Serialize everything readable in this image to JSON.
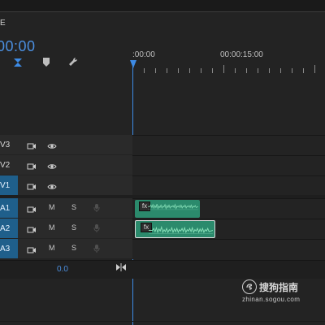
{
  "window": {
    "panel_tab_glyph": "E"
  },
  "timeline": {
    "timecode": "00:00",
    "ruler": {
      "labels": [
        ":00:00",
        "00:00:15:00"
      ]
    },
    "audio_meter_value": "0.0"
  },
  "tracks": {
    "video": [
      {
        "name": "V3",
        "active": false
      },
      {
        "name": "V2",
        "active": false
      },
      {
        "name": "V1",
        "active": true
      }
    ],
    "audio": [
      {
        "name": "A1",
        "active": true,
        "m": "M",
        "s": "S"
      },
      {
        "name": "A2",
        "active": true,
        "m": "M",
        "s": "S"
      },
      {
        "name": "A3",
        "active": true,
        "m": "M",
        "s": "S"
      }
    ]
  },
  "clips": {
    "a1_fx": "fx",
    "a2_fx": "fx"
  },
  "watermark": {
    "brand": "搜狗指南",
    "domain": "zhinan.sogou.com"
  },
  "colors": {
    "accent_blue": "#3d8be5",
    "track_active": "#1f5f8b",
    "clip_green": "#2b8a6c"
  }
}
